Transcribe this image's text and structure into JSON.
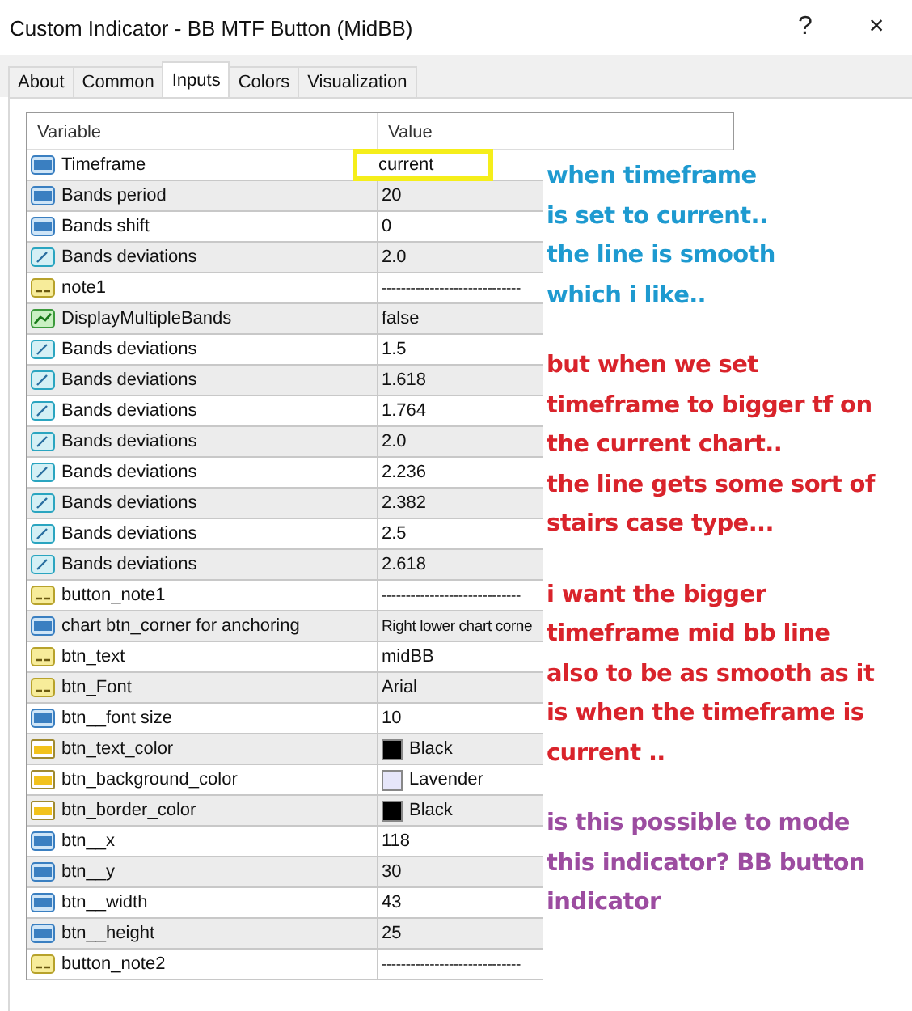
{
  "window": {
    "title": "Custom Indicator - BB MTF Button (MidBB)",
    "help": "?",
    "close": "×"
  },
  "tabs": [
    {
      "label": "About",
      "selected": false
    },
    {
      "label": "Common",
      "selected": false
    },
    {
      "label": "Inputs",
      "selected": true
    },
    {
      "label": "Colors",
      "selected": false
    },
    {
      "label": "Visualization",
      "selected": false
    }
  ],
  "table": {
    "columns": [
      "Variable",
      "Value"
    ],
    "rows": [
      {
        "kind": "int",
        "variable": "Timeframe",
        "value": "current",
        "highlighted": true
      },
      {
        "kind": "int",
        "variable": "Bands period",
        "value": "20",
        "highlighted": false
      },
      {
        "kind": "int",
        "variable": "Bands shift",
        "value": "0",
        "highlighted": false
      },
      {
        "kind": "double",
        "variable": "Bands deviations",
        "value": "2.0",
        "highlighted": false
      },
      {
        "kind": "string",
        "variable": "note1",
        "value": "-----------------------------",
        "highlighted": false
      },
      {
        "kind": "bool",
        "variable": "DisplayMultipleBands",
        "value": "false",
        "highlighted": false
      },
      {
        "kind": "double",
        "variable": "Bands deviations",
        "value": "1.5",
        "highlighted": false
      },
      {
        "kind": "double",
        "variable": "Bands deviations",
        "value": "1.618",
        "highlighted": false
      },
      {
        "kind": "double",
        "variable": "Bands deviations",
        "value": "1.764",
        "highlighted": false
      },
      {
        "kind": "double",
        "variable": "Bands deviations",
        "value": "2.0",
        "highlighted": false
      },
      {
        "kind": "double",
        "variable": "Bands deviations",
        "value": "2.236",
        "highlighted": false
      },
      {
        "kind": "double",
        "variable": "Bands deviations",
        "value": "2.382",
        "highlighted": false
      },
      {
        "kind": "double",
        "variable": "Bands deviations",
        "value": "2.5",
        "highlighted": false
      },
      {
        "kind": "double",
        "variable": "Bands deviations",
        "value": "2.618",
        "highlighted": false
      },
      {
        "kind": "string",
        "variable": "button_note1",
        "value": "-----------------------------",
        "highlighted": false
      },
      {
        "kind": "int",
        "variable": "chart btn_corner for anchoring",
        "value": "Right lower chart corne",
        "highlighted": false
      },
      {
        "kind": "string",
        "variable": "btn_text",
        "value": "midBB",
        "highlighted": false
      },
      {
        "kind": "string",
        "variable": "btn_Font",
        "value": "Arial",
        "highlighted": false
      },
      {
        "kind": "int",
        "variable": "btn__font size",
        "value": "10",
        "highlighted": false
      },
      {
        "kind": "color",
        "variable": "btn_text_color",
        "value": "Black",
        "color": "#000000",
        "highlighted": false
      },
      {
        "kind": "color",
        "variable": "btn_background_color",
        "value": "Lavender",
        "color": "#e6e6fa",
        "highlighted": false
      },
      {
        "kind": "color",
        "variable": "btn_border_color",
        "value": "Black",
        "color": "#000000",
        "highlighted": false
      },
      {
        "kind": "int",
        "variable": "btn__x",
        "value": "118",
        "highlighted": false
      },
      {
        "kind": "int",
        "variable": "btn__y",
        "value": "30",
        "highlighted": false
      },
      {
        "kind": "int",
        "variable": "btn__width",
        "value": "43",
        "highlighted": false
      },
      {
        "kind": "int",
        "variable": "btn__height",
        "value": "25",
        "highlighted": false
      },
      {
        "kind": "string",
        "variable": "button_note2",
        "value": "-----------------------------",
        "highlighted": false
      }
    ]
  },
  "notes": [
    {
      "color": "#1e9ad0",
      "lines": [
        "when timeframe",
        "is set to current..",
        "the line is smooth",
        "which i like.."
      ]
    },
    {
      "color": "#d9232b",
      "lines": [
        "but when we set",
        "timeframe to bigger tf on",
        "the current chart..",
        "the line gets some sort of",
        "stairs case type..."
      ]
    },
    {
      "color": "#d9232b",
      "lines": [
        "i want the bigger",
        "timeframe mid bb line",
        "also to be as smooth as it",
        "is when the timeframe is",
        "current .."
      ]
    },
    {
      "color": "#9c4ca0",
      "lines": [
        "is this possible to mode",
        "this indicator? BB button",
        "indicator"
      ]
    }
  ]
}
